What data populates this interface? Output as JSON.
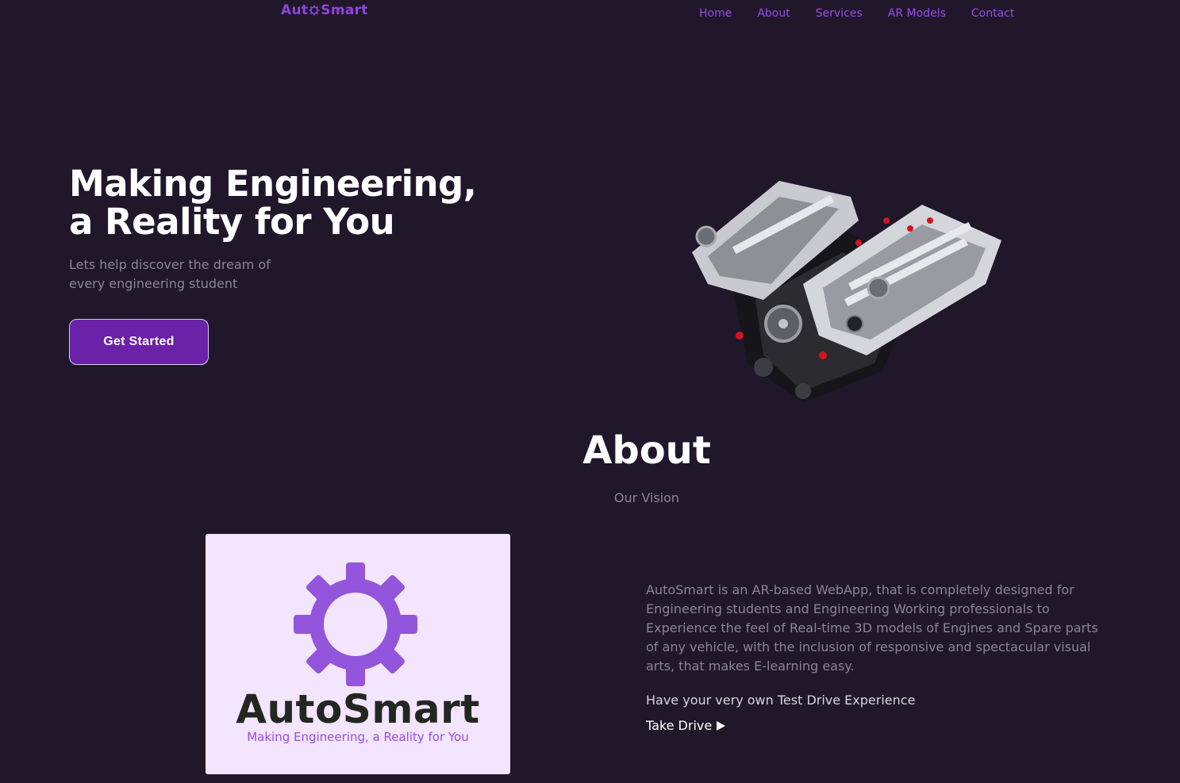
{
  "nav": {
    "logo_left": "Aut",
    "logo_right": "Smart",
    "links": [
      "Home",
      "About",
      "Services",
      "AR Models",
      "Contact"
    ]
  },
  "hero": {
    "title_line1": "Making Engineering,",
    "title_line2": "a Reality for You",
    "subtitle": "Lets help discover the dream of every engineering student",
    "cta_label": "Get Started"
  },
  "about": {
    "title": "About",
    "subtitle": "Our Vision",
    "body": "AutoSmart is an AR-based WebApp, that is completely designed for Engineering students and Engineering Working professionals to Experience the feel of Real-time 3D models of Engines and Spare parts of any vehicle, with the inclusion of responsive and spectacular visual arts, that makes E-learning easy.",
    "test_drive": "Have your very own Test Drive Experience",
    "take_drive": "Take Drive"
  },
  "card": {
    "brand": "AutoSmart",
    "tagline": "Making Engineering, a Reality for You"
  },
  "colors": {
    "background": "#20172b",
    "accent": "#9a4be8",
    "button": "#6b21a8",
    "card": "#f3e5fd"
  }
}
